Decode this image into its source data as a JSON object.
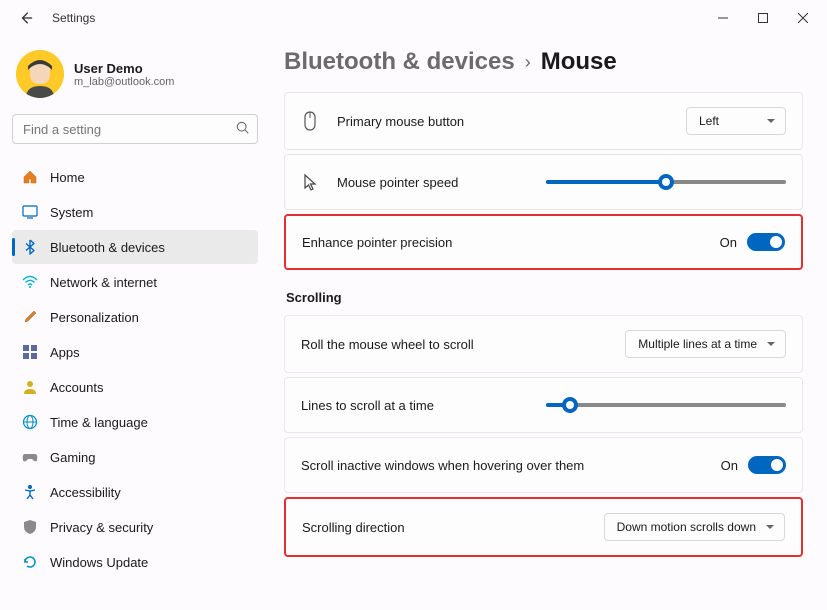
{
  "titlebar": {
    "title": "Settings"
  },
  "profile": {
    "name": "User Demo",
    "email": "m_lab@outlook.com"
  },
  "search": {
    "placeholder": "Find a setting"
  },
  "nav": {
    "items": [
      {
        "label": "Home"
      },
      {
        "label": "System"
      },
      {
        "label": "Bluetooth & devices"
      },
      {
        "label": "Network & internet"
      },
      {
        "label": "Personalization"
      },
      {
        "label": "Apps"
      },
      {
        "label": "Accounts"
      },
      {
        "label": "Time & language"
      },
      {
        "label": "Gaming"
      },
      {
        "label": "Accessibility"
      },
      {
        "label": "Privacy & security"
      },
      {
        "label": "Windows Update"
      }
    ]
  },
  "breadcrumb": {
    "parent": "Bluetooth & devices",
    "current": "Mouse"
  },
  "settings": {
    "primary_button": {
      "label": "Primary mouse button",
      "value": "Left"
    },
    "pointer_speed": {
      "label": "Mouse pointer speed",
      "value_pct": 50
    },
    "enhance_precision": {
      "label": "Enhance pointer precision",
      "state": "On"
    },
    "scrolling_heading": "Scrolling",
    "wheel_scroll": {
      "label": "Roll the mouse wheel to scroll",
      "value": "Multiple lines at a time"
    },
    "lines_scroll": {
      "label": "Lines to scroll at a time",
      "value_pct": 10
    },
    "inactive_windows": {
      "label": "Scroll inactive windows when hovering over them",
      "state": "On"
    },
    "scroll_direction": {
      "label": "Scrolling direction",
      "value": "Down motion scrolls down"
    }
  }
}
